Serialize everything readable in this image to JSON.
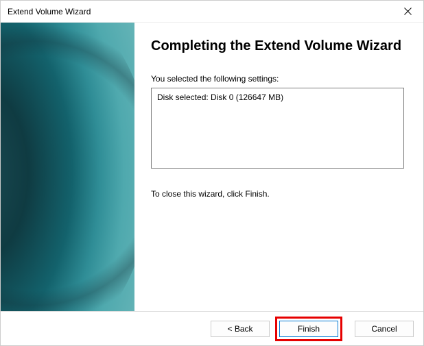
{
  "titlebar": {
    "title": "Extend Volume Wizard"
  },
  "main": {
    "heading": "Completing the Extend Volume Wizard",
    "settings_label": "You selected the following settings:",
    "settings_value": "Disk selected: Disk 0 (126647 MB)",
    "instruction": "To close this wizard, click Finish."
  },
  "buttons": {
    "back": "< Back",
    "finish": "Finish",
    "cancel": "Cancel"
  }
}
